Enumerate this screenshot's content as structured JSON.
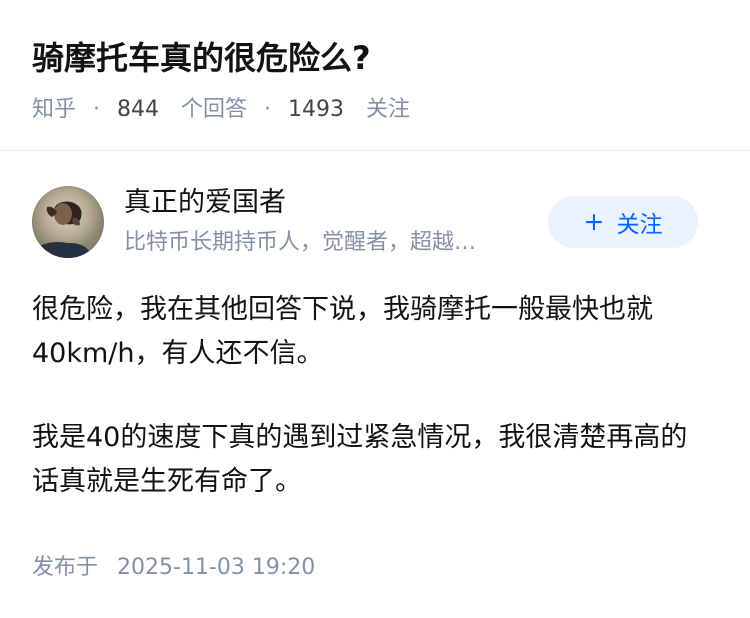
{
  "question": {
    "title": "骑摩托车真的很危险么?",
    "source": "知乎",
    "answer_count": "844",
    "answer_label": "个回答",
    "follower_count": "1493",
    "follower_label": "关注",
    "separator": "·"
  },
  "author": {
    "name": "真正的爱国者",
    "headline": "比特币长期持币人，觉醒者，超越…",
    "follow_button": {
      "icon": "+",
      "label": "关注"
    }
  },
  "answer": {
    "paragraphs": [
      "很危险，我在其他回答下说，我骑摩托一般最快也就40km/h，有人还不信。",
      "我是40的速度下真的遇到过紧急情况，我很清楚再高的话真就是生死有命了。"
    ],
    "publish_label": "发布于",
    "publish_time": "2025-11-03 19:20"
  },
  "colors": {
    "title_text": "#121212",
    "meta_text": "#8590a6",
    "follow_button_bg": "#eaf2ff",
    "follow_button_text": "#0066ff",
    "divider": "#ebebeb"
  }
}
